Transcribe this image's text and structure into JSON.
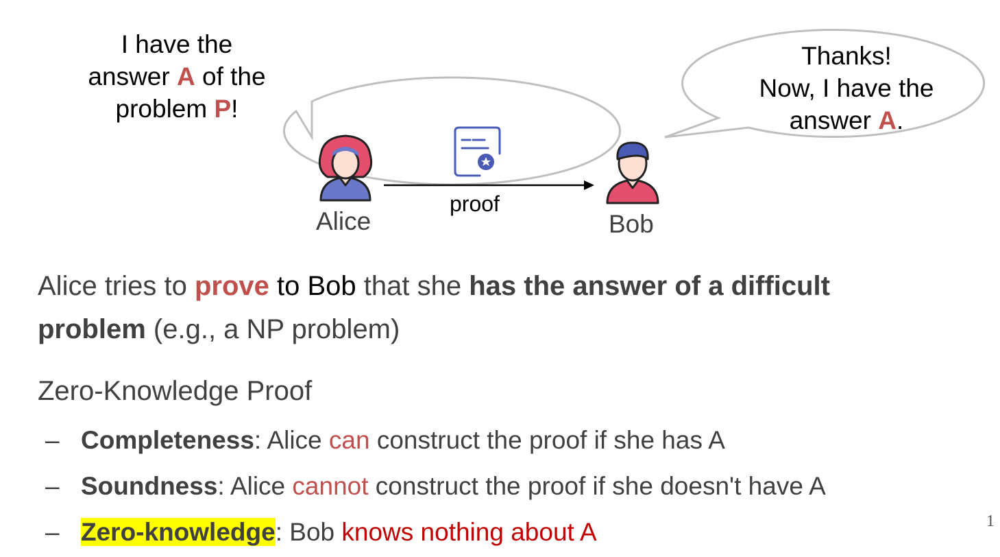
{
  "alice_bubble": {
    "line1": "I have the",
    "line2_pre": "answer ",
    "line2_hl": "A",
    "line2_post": " of the",
    "line3_pre": "problem ",
    "line3_hl": "P",
    "line3_post": "!"
  },
  "bob_bubble": {
    "line1": "Thanks!",
    "line2": "Now, I have the",
    "line3_pre": "answer ",
    "line3_hl": "A",
    "line3_post": "."
  },
  "alice_label": "Alice",
  "bob_label": "Bob",
  "proof_label": "proof",
  "statement": {
    "p1": "Alice tries to ",
    "prove": "prove",
    "p2": " to Bob",
    "p3": " that she ",
    "bold1": "has the answer of a difficult",
    "bold2": "problem",
    "p4": " (e.g., a NP problem)"
  },
  "zkp_heading": "Zero-Knowledge Proof",
  "bullets": [
    {
      "dash": "–",
      "term": "Completeness",
      "sep": ": Alice ",
      "hl": "can",
      "rest": " construct the proof if she has A"
    },
    {
      "dash": "–",
      "term": "Soundness",
      "sep": ": Alice ",
      "hl": "cannot",
      "rest": " construct the proof if she doesn't have A"
    },
    {
      "dash": "–",
      "term": "Zero-knowledge",
      "sep": ": Bob ",
      "hl": "knows nothing about A",
      "rest": ""
    }
  ],
  "page_number": "1",
  "colors": {
    "accent": "#c0504d",
    "dark_red": "#c00000",
    "highlight": "#ffff00",
    "text": "#404040"
  },
  "icons": [
    "alice-avatar-icon",
    "bob-avatar-icon",
    "certificate-icon",
    "arrow-right-icon"
  ]
}
